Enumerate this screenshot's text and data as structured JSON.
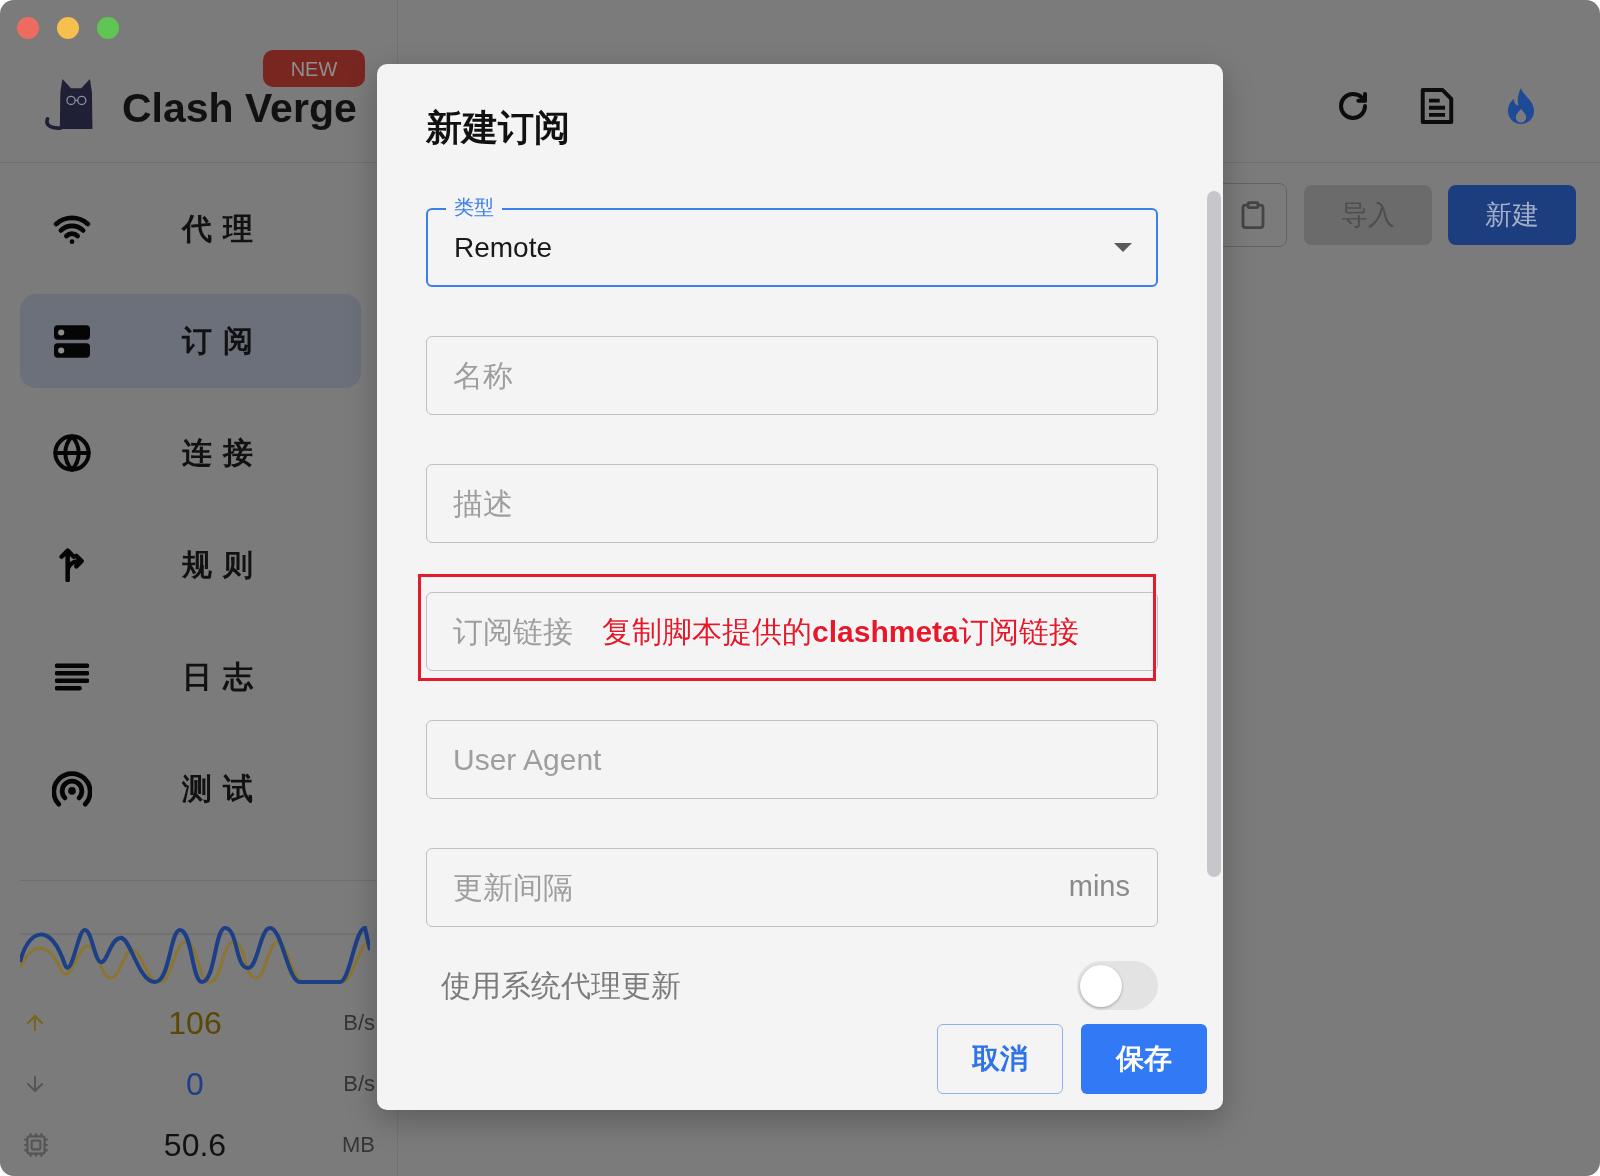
{
  "sidebar": {
    "logo": {
      "title": "Clash Verge",
      "badge": "NEW"
    },
    "items": [
      {
        "label": "代理",
        "selected": false
      },
      {
        "label": "订阅",
        "selected": true
      },
      {
        "label": "连接",
        "selected": false
      },
      {
        "label": "规则",
        "selected": false
      },
      {
        "label": "日志",
        "selected": false
      },
      {
        "label": "测试",
        "selected": false
      }
    ],
    "traffic": [
      {
        "kind": "upload",
        "value": "106",
        "unit": "B/s"
      },
      {
        "kind": "download",
        "value": "0",
        "unit": "B/s"
      },
      {
        "kind": "memory",
        "value": "50.6",
        "unit": "MB"
      }
    ]
  },
  "toolbar": {
    "buttons": [
      {
        "label": "导入",
        "disabled": true
      },
      {
        "label": "新建",
        "disabled": false
      }
    ]
  },
  "dialog": {
    "title": "新建订阅",
    "fields": [
      {
        "kind": "select",
        "label": "类型",
        "value": "Remote",
        "focused": true
      },
      {
        "kind": "text",
        "placeholder": "名称",
        "focused": false
      },
      {
        "kind": "text",
        "placeholder": "描述",
        "focused": false
      },
      {
        "kind": "text",
        "placeholder": "订阅链接",
        "focused": false,
        "annotation": {
          "text": "复制脚本提供的**clashmeta**订阅链接"
        }
      },
      {
        "kind": "text",
        "placeholder": "User Agent",
        "focused": false
      },
      {
        "kind": "text",
        "placeholder": "更新间隔",
        "suffix": "mins",
        "focused": false
      }
    ],
    "switch": {
      "label": "使用系统代理更新",
      "on": false
    },
    "buttons": [
      {
        "label": "取消",
        "kind": "outlined"
      },
      {
        "label": "保存",
        "kind": "contained"
      }
    ]
  }
}
